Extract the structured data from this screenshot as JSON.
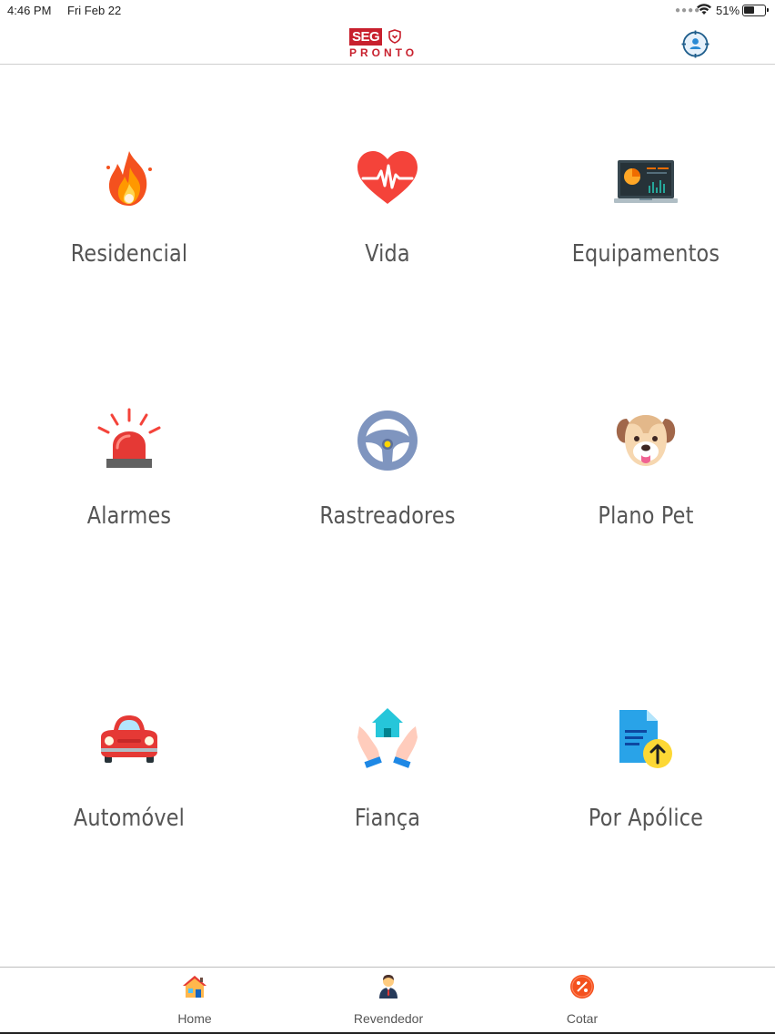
{
  "status_bar": {
    "time": "4:46 PM",
    "date": "Fri Feb 22",
    "battery_pct": "51%",
    "battery_level": 0.51
  },
  "header": {
    "logo_top": "SEG",
    "logo_bottom": "PRONTO",
    "profile_icon": "user-target-icon"
  },
  "tiles": [
    {
      "label": "Residencial",
      "icon": "fire-icon"
    },
    {
      "label": "Vida",
      "icon": "heartbeat-icon"
    },
    {
      "label": "Equipamentos",
      "icon": "laptop-chart-icon"
    },
    {
      "label": "Alarmes",
      "icon": "siren-icon"
    },
    {
      "label": "Rastreadores",
      "icon": "steering-wheel-icon"
    },
    {
      "label": "Plano Pet",
      "icon": "dog-icon"
    },
    {
      "label": "Automóvel",
      "icon": "car-icon"
    },
    {
      "label": "Fiança",
      "icon": "house-hands-icon"
    },
    {
      "label": "Por Apólice",
      "icon": "document-upload-icon"
    }
  ],
  "tabs": [
    {
      "label": "Home",
      "icon": "home-icon"
    },
    {
      "label": "Revendedor",
      "icon": "reseller-person-icon"
    },
    {
      "label": "Cotar",
      "icon": "discount-badge-icon"
    }
  ],
  "colors": {
    "brand_red": "#c8202d",
    "label_gray": "#555555",
    "divider": "#cfcfcf"
  }
}
